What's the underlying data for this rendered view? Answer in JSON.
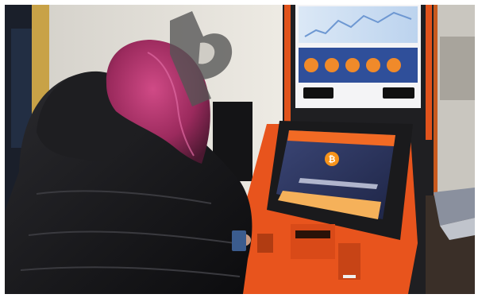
{
  "scene": {
    "colors": {
      "kiosk_orange": "#e8541d",
      "kiosk_dark": "#1d1d20",
      "screen_blue": "#2b3560",
      "banner_orange": "#f26a24",
      "hair_magenta": "#b0306a",
      "jacket": "#151517",
      "wall": "#e6e3dc"
    },
    "watermark": {
      "icon": "bitcoin-shape-icon",
      "color": "#555555"
    },
    "atm_screen": {
      "brand": "bitcoin",
      "icon": "bitcoin-coin-icon"
    },
    "poster": {
      "icons": [
        "app-store-badge-icon",
        "google-play-badge-icon"
      ]
    }
  }
}
